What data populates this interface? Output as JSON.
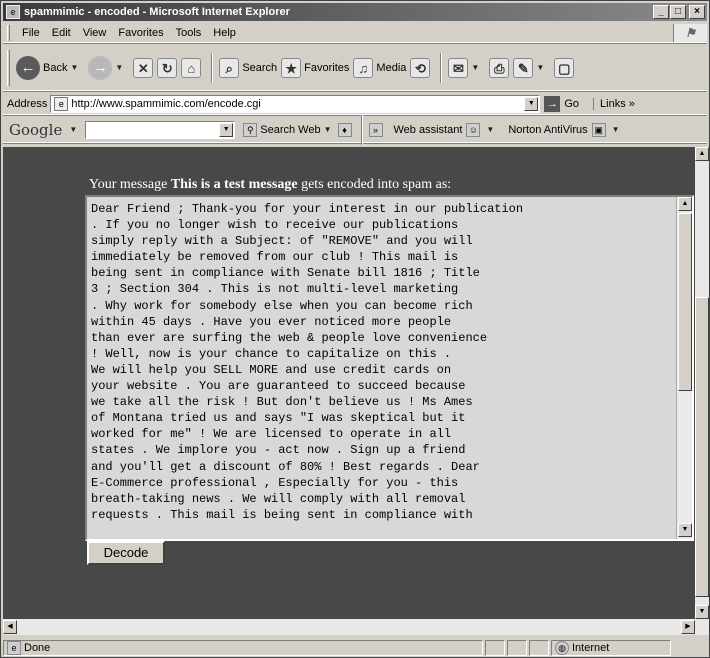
{
  "window": {
    "title": "spammimic - encoded - Microsoft Internet Explorer",
    "min": "_",
    "max": "□",
    "close": "×"
  },
  "menu": [
    "File",
    "Edit",
    "View",
    "Favorites",
    "Tools",
    "Help"
  ],
  "toolbar": {
    "back": "Back",
    "search": "Search",
    "favorites": "Favorites",
    "media": "Media"
  },
  "address": {
    "label": "Address",
    "url": "http://www.spammimic.com/encode.cgi",
    "go": "Go",
    "links": "Links »"
  },
  "googlebar": {
    "logo": "Google",
    "search_web": "Search Web",
    "web_assistant": "Web assistant",
    "antivirus": "Norton AntiVirus"
  },
  "page": {
    "intro_prefix": "Your message ",
    "intro_message": "This is a test message",
    "intro_suffix": " gets encoded into spam as:",
    "encoded_lines": [
      "Dear Friend ; Thank-you for your interest in our publication",
      ". If you no longer wish to receive our publications",
      "simply reply with a Subject: of \"REMOVE\" and you will",
      "immediately be removed from our club ! This mail is",
      "being sent in compliance with Senate bill 1816 ; Title",
      "3 ; Section 304 . This is not multi-level marketing",
      ". Why work for somebody else when you can become rich",
      "within 45 days . Have you ever noticed more people",
      "than ever are surfing the web & people love convenience",
      "! Well, now is your chance to capitalize on this .",
      "We will help you SELL MORE and use credit cards on",
      "your website . You are guaranteed to succeed because",
      "we take all the risk ! But don't believe us ! Ms Ames",
      "of Montana tried us and says \"I was skeptical but it",
      "worked for me\" ! We are licensed to operate in all",
      "states . We implore you - act now . Sign up a friend",
      "and you'll get a discount of 80% ! Best regards . Dear",
      "E-Commerce professional , Especially for you - this",
      "breath-taking news . We will comply with all removal",
      "requests . This mail is being sent in compliance with"
    ],
    "decode_button": "Decode"
  },
  "status": {
    "text": "Done",
    "zone": "Internet"
  }
}
